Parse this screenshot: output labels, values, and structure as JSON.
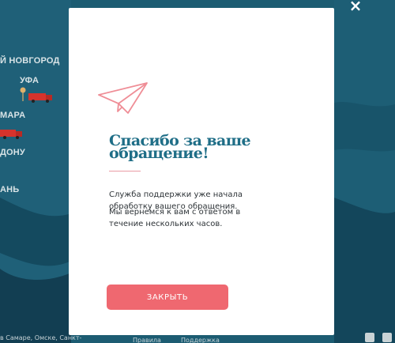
{
  "map": {
    "cities": [
      "Й НОВГОРОД",
      "УФА",
      "МАРА",
      "ДОНУ",
      "АНЬ"
    ],
    "footer_text": "в Самаре, Омске, Санкт-",
    "footer_links": [
      "Правила",
      "Поддержка"
    ]
  },
  "modal": {
    "title_line1": "Спасибо за ваше",
    "title_line2": "обращение!",
    "text1": "Служба поддержки уже начала обработку вашего обращения.",
    "text2": "Мы вернемся к вам с ответом в течение нескольких часов.",
    "close_button": "ЗАКРЫТЬ",
    "close_icon": "×",
    "icon": "paper-plane-icon"
  },
  "colors": {
    "accent": "#ef6870",
    "title": "#1f6e87",
    "map_dark": "#0f3a4d",
    "map_mid": "#1c5d74"
  }
}
